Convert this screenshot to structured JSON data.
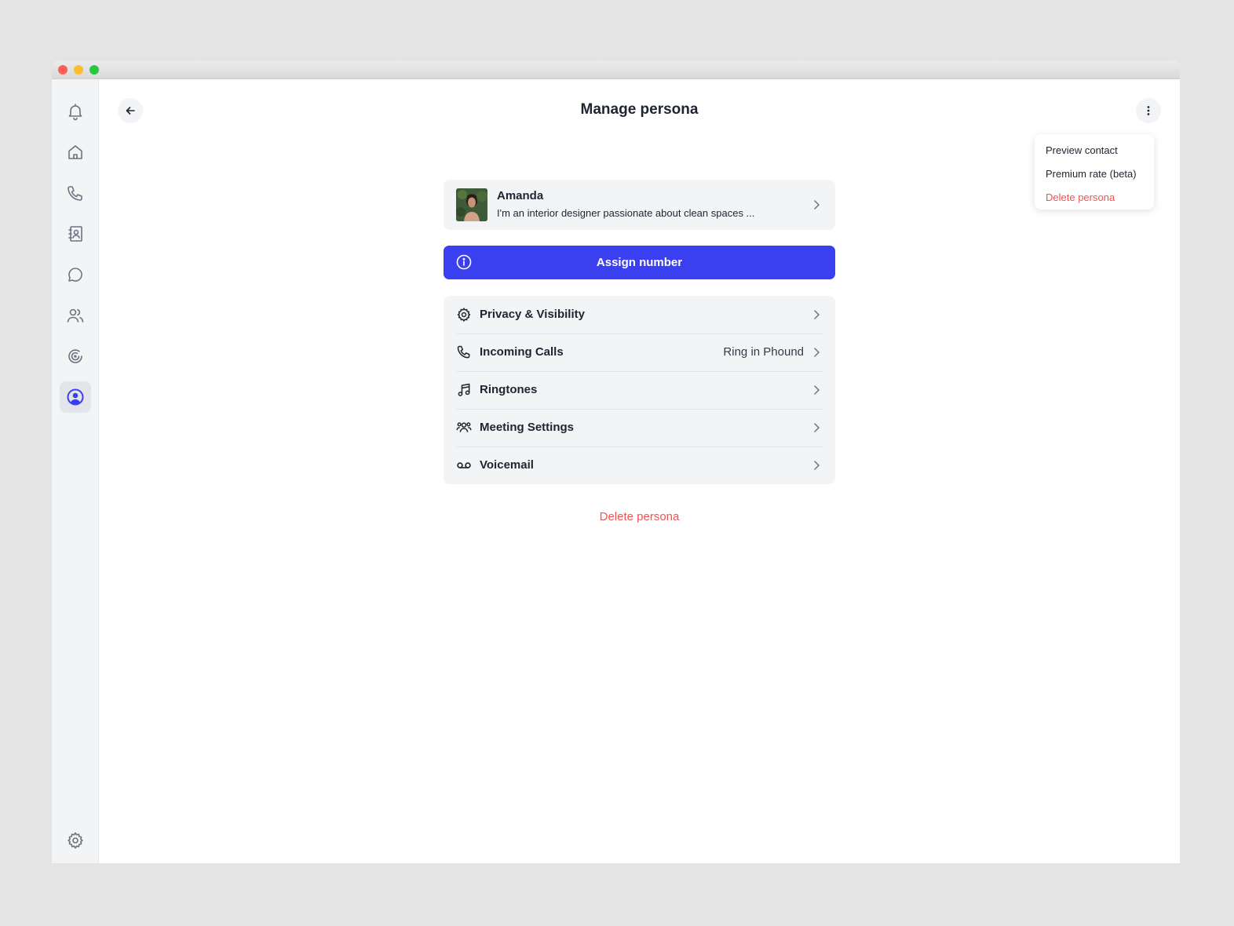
{
  "window": {
    "controls": [
      "close",
      "minimize",
      "zoom"
    ]
  },
  "sidebar": {
    "items": [
      {
        "name": "notifications",
        "icon": "bell-icon"
      },
      {
        "name": "home",
        "icon": "home-icon"
      },
      {
        "name": "calls",
        "icon": "phone-icon"
      },
      {
        "name": "contacts",
        "icon": "contacts-book-icon"
      },
      {
        "name": "messages",
        "icon": "chat-icon"
      },
      {
        "name": "team",
        "icon": "users-icon"
      },
      {
        "name": "activity",
        "icon": "spiral-icon"
      },
      {
        "name": "persona",
        "icon": "user-circle-icon",
        "active": true
      }
    ],
    "bottom": {
      "name": "settings",
      "icon": "gear-icon"
    }
  },
  "header": {
    "title": "Manage persona"
  },
  "menu": {
    "items": [
      {
        "label": "Preview contact",
        "danger": false
      },
      {
        "label": "Premium rate (beta)",
        "danger": false
      },
      {
        "label": "Delete persona",
        "danger": true
      }
    ]
  },
  "profile": {
    "name": "Amanda",
    "bio": "I'm an interior designer passionate about clean spaces ..."
  },
  "assign": {
    "label": "Assign number"
  },
  "settings": {
    "rows": [
      {
        "label": "Privacy & Visibility",
        "icon": "gear-icon",
        "value": ""
      },
      {
        "label": "Incoming Calls",
        "icon": "phone-icon",
        "value": "Ring in Phound"
      },
      {
        "label": "Ringtones",
        "icon": "music-note-icon",
        "value": ""
      },
      {
        "label": "Meeting Settings",
        "icon": "users-group-icon",
        "value": ""
      },
      {
        "label": "Voicemail",
        "icon": "voicemail-icon",
        "value": ""
      }
    ]
  },
  "footer": {
    "delete_label": "Delete persona"
  },
  "colors": {
    "accent": "#3a40ef",
    "danger": "#f05252",
    "card_bg": "#f3f4f6",
    "sidebar_bg": "#f3f4f6"
  }
}
